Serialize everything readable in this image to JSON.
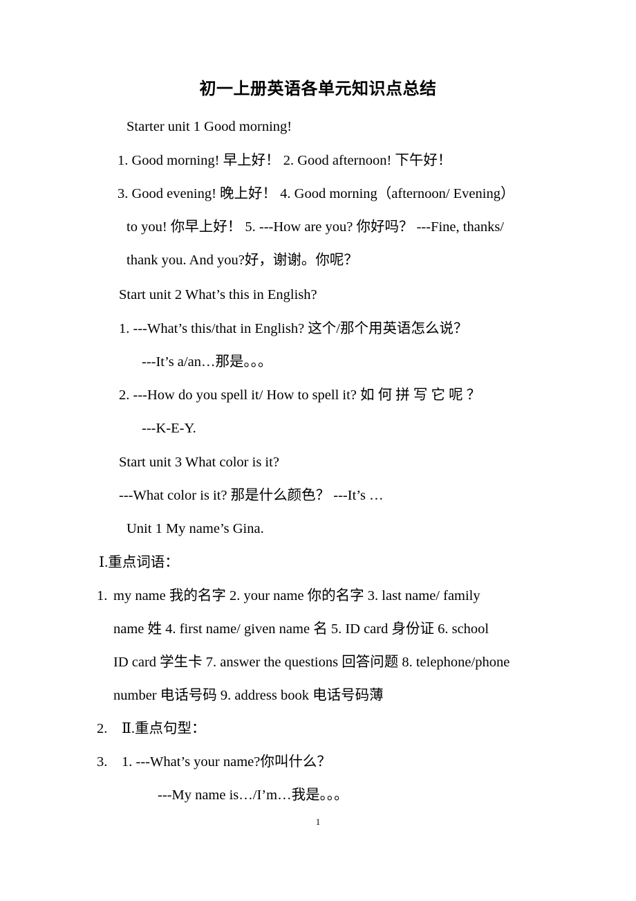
{
  "document": {
    "title": "初一上册英语各单元知识点总结",
    "page_number": "1"
  },
  "body_lines": {
    "l1": "Starter unit 1 Good morning!",
    "l2": "1. Good morning!  早上好！   2. Good afternoon!    下午好！",
    "l3": "3. Good evening!  晚上好！   4. Good morning（afternoon/ Evening）",
    "l4": "to you!  你早上好！   5. ---How are you?  你好吗？   ---Fine, thanks/",
    "l5": "thank you.    And you?好，谢谢。你呢？",
    "l6": "Start unit 2    What’s this in English?",
    "l7": "1. ---What’s this/that in English?          这个/那个用英语怎么说？",
    "l8": "---It’s a/an…那是。。。",
    "l9": "2.  ---How  do  you  spell  it/  How  to  spell  it?  如 何 拼 写 它 呢 ？",
    "l10": "---K-E-Y.",
    "l11": "Start unit 3     What color is it?",
    "l12": "---What color is it?   那是什么颜色？   ---It’s …",
    "l13": "Unit 1 My name’s Gina.",
    "l14": "Ⅰ.重点词语："
  },
  "numbered_list": [
    {
      "marker": "1.",
      "lines": [
        "my name  我的名字  2. your name  你的名字    3. last name/ family",
        "name  姓  4. first name/ given name  名  5. ID card  身份证    6. school",
        "ID card  学生卡    7. answer the questions  回答问题  8. telephone/phone",
        "number  电话号码  9. address book  电话号码薄"
      ]
    },
    {
      "marker": "2.",
      "lines": [
        "Ⅱ.重点句型："
      ]
    },
    {
      "marker": "3.",
      "lines": [
        "1. ---What’s your name?你叫什么？",
        "---My name is…/I’m…我是。。。"
      ]
    }
  ]
}
